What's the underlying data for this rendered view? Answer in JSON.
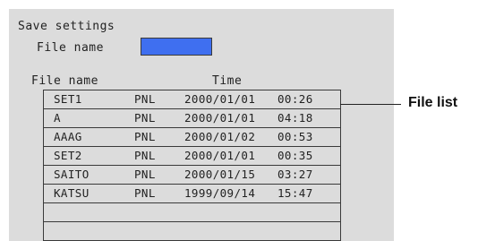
{
  "panel": {
    "title": "Save settings",
    "file_name_label": "File name",
    "file_name_value": ""
  },
  "list_header": {
    "name": "File name",
    "time": "Time"
  },
  "files": [
    {
      "name": "SET1",
      "type": "PNL",
      "date": "2000/01/01",
      "time": "00:26"
    },
    {
      "name": "A",
      "type": "PNL",
      "date": "2000/01/01",
      "time": "04:18"
    },
    {
      "name": "AAAG",
      "type": "PNL",
      "date": "2000/01/02",
      "time": "00:53"
    },
    {
      "name": "SET2",
      "type": "PNL",
      "date": "2000/01/01",
      "time": "00:35"
    },
    {
      "name": "SAITO",
      "type": "PNL",
      "date": "2000/01/15",
      "time": "03:27"
    },
    {
      "name": "KATSU",
      "type": "PNL",
      "date": "1999/09/14",
      "time": "15:47"
    },
    {
      "name": "",
      "type": "",
      "date": "",
      "time": ""
    },
    {
      "name": "",
      "type": "",
      "date": "",
      "time": ""
    }
  ],
  "annotation": {
    "label": "File list"
  },
  "colors": {
    "panel_background": "#dcdcdc",
    "input_highlight": "#3f6ff0",
    "border": "#3a3a3a"
  }
}
